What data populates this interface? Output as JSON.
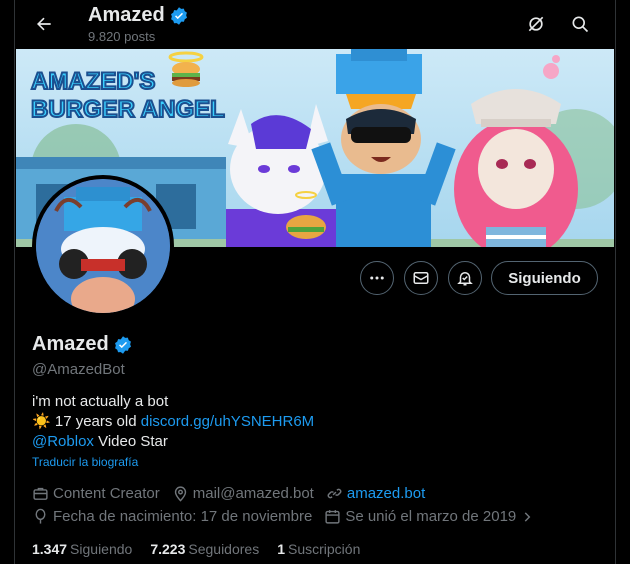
{
  "header": {
    "name": "Amazed",
    "posts": "9.820 posts"
  },
  "banner": {
    "title_line1": "AMAZED'S",
    "title_line2": "BURGER ANGEL"
  },
  "actions": {
    "follow_label": "Siguiendo"
  },
  "profile": {
    "name": "Amazed",
    "handle": "@AmazedBot",
    "bio_line1": "i'm not actually a bot",
    "bio_line2_emoji": "☀️",
    "bio_line2_text": " 17 years old ",
    "bio_line2_link": "discord.gg/uhYSNEHR6M",
    "bio_line3_link": "@Roblox",
    "bio_line3_text": " Video Star",
    "translate": "Traducir la biografía"
  },
  "meta": {
    "category": "Content Creator",
    "email": "mail@amazed.bot",
    "website": "amazed.bot",
    "birthday": "Fecha de nacimiento: 17 de noviembre",
    "joined": "Se unió el marzo de 2019"
  },
  "stats": {
    "following_count": "1.347",
    "following_label": "Siguiendo",
    "followers_count": "7.223",
    "followers_label": "Seguidores",
    "subs_count": "1",
    "subs_label": "Suscripción"
  },
  "colors": {
    "accent": "#1d9bf0",
    "muted": "#71767b",
    "border": "#2f3336"
  }
}
